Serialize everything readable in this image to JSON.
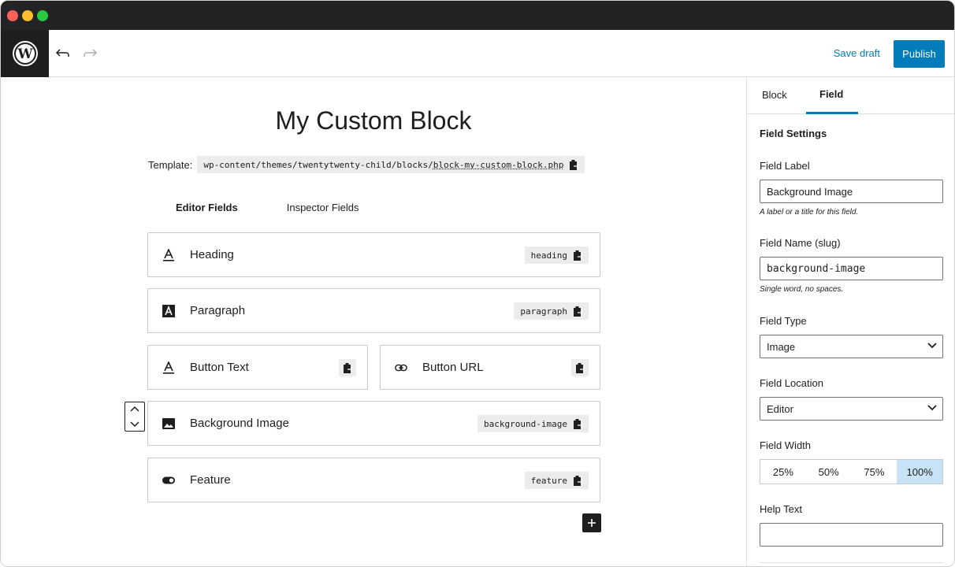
{
  "toolbar": {
    "save_draft_label": "Save draft",
    "publish_label": "Publish"
  },
  "editor": {
    "block_title": "My Custom Block",
    "template_label": "Template:",
    "template_path_dir": "wp-content/themes/twentytwenty-child/blocks/",
    "template_path_file": "block-my-custom-block.php",
    "tabs": [
      "Editor Fields",
      "Inspector Fields"
    ],
    "active_tab": "Editor Fields",
    "fields": [
      {
        "label": "Heading",
        "slug": "heading",
        "icon": "text-a-icon"
      },
      {
        "label": "Paragraph",
        "slug": "paragraph",
        "icon": "paragraph-icon"
      },
      {
        "label": "Button Text",
        "slug": "",
        "icon": "text-a-icon"
      },
      {
        "label": "Button URL",
        "slug": "",
        "icon": "link-icon"
      },
      {
        "label": "Background Image",
        "slug": "background-image",
        "icon": "image-icon"
      },
      {
        "label": "Feature",
        "slug": "feature",
        "icon": "toggle-icon"
      }
    ]
  },
  "sidebar": {
    "tabs": [
      "Block",
      "Field"
    ],
    "active_tab": "Field",
    "heading": "Field Settings",
    "field_label": {
      "label": "Field Label",
      "value": "Background Image",
      "help": "A label or a title for this field."
    },
    "field_name": {
      "label": "Field Name (slug)",
      "value": "background-image",
      "help": "Single word, no spaces."
    },
    "field_type": {
      "label": "Field Type",
      "value": "Image"
    },
    "field_location": {
      "label": "Field Location",
      "value": "Editor"
    },
    "field_width": {
      "label": "Field Width",
      "options": [
        "25%",
        "50%",
        "75%",
        "100%"
      ],
      "selected": "100%"
    },
    "help_text": {
      "label": "Help Text",
      "value": ""
    }
  },
  "colors": {
    "accent": "#007cba",
    "dark": "#1e1e1e",
    "selected_width": "#c9e3f6"
  }
}
